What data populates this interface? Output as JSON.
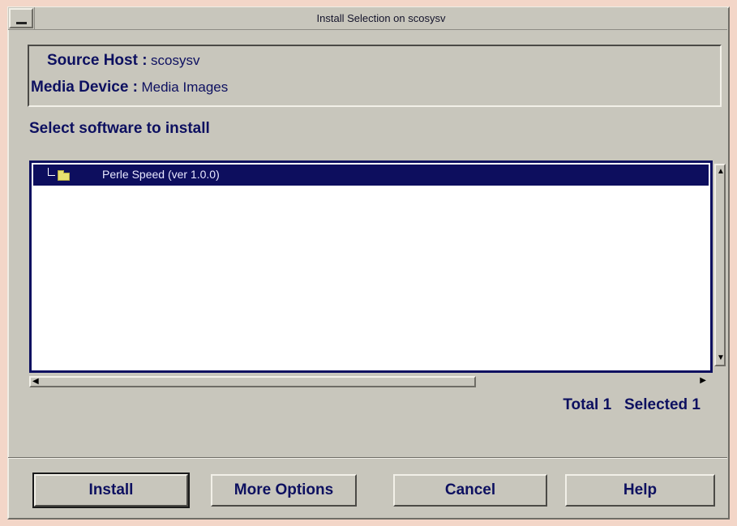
{
  "window": {
    "title": "Install Selection on scosysv",
    "menu_icon": "window-menu-icon"
  },
  "info": {
    "source_host_label": "Source Host :",
    "source_host_value": "scosysv",
    "media_device_label": "Media Device :",
    "media_device_value": "Media Images"
  },
  "list": {
    "heading": "Select software to install",
    "items": [
      {
        "label": "Perle Speed (ver 1.0.0)",
        "icon": "folder-icon",
        "selected": true
      }
    ]
  },
  "counts": {
    "text": "Total 1   Selected 1"
  },
  "buttons": {
    "install": "Install",
    "more_options": "More Options",
    "cancel": "Cancel",
    "help": "Help"
  },
  "colors": {
    "background": "#c8c6bc",
    "text": "#0d1060",
    "selection": "#0d0e5e",
    "folder": "#e8e070"
  }
}
